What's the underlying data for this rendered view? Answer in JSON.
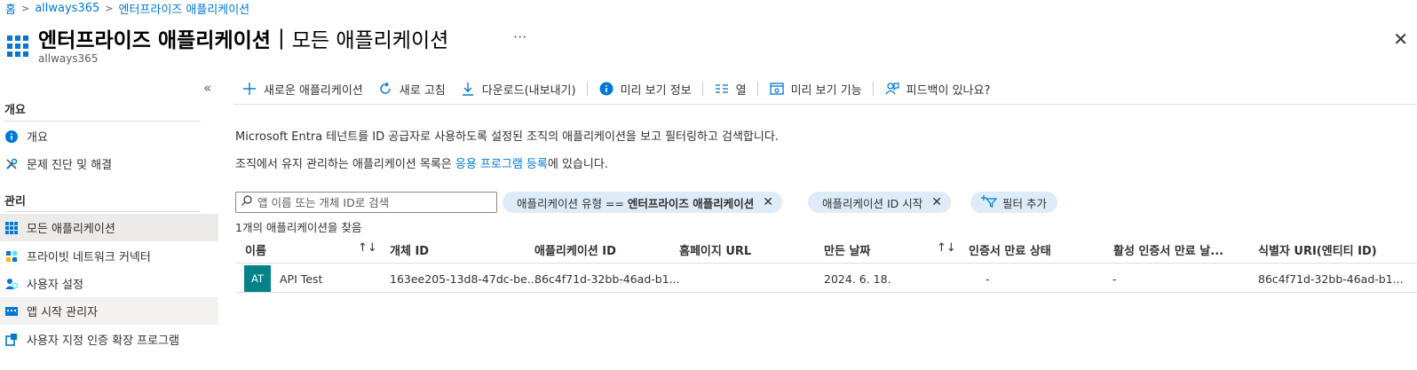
{
  "breadcrumb": {
    "items": [
      "홈",
      "allways365",
      "엔터프라이즈 애플리케이션"
    ]
  },
  "header": {
    "title": "엔터프라이즈 애플리케이션",
    "separator": "|",
    "title_sub": "모든 애플리케이션",
    "more": "···",
    "subtitle": "allways365",
    "close": "✕"
  },
  "nav": {
    "collapse": "«",
    "sections": [
      {
        "heading": "개요",
        "items": [
          {
            "label": "개요",
            "icon": "info-icon"
          },
          {
            "label": "문제 진단 및 해결",
            "icon": "wrench-icon"
          }
        ]
      },
      {
        "heading": "관리",
        "items": [
          {
            "label": "모든 애플리케이션",
            "icon": "grid-icon",
            "selected": true
          },
          {
            "label": "프라이빗 네트워크 커넥터",
            "icon": "connector-icon"
          },
          {
            "label": "사용자 설정",
            "icon": "users-settings-icon"
          },
          {
            "label": "앱 시작 관리자",
            "icon": "app-launcher-icon"
          },
          {
            "label": "사용자 지정 인증 확장 프로그램",
            "icon": "extension-icon"
          }
        ]
      }
    ]
  },
  "toolbar": {
    "new_app": "새로운 애플리케이션",
    "refresh": "새로 고침",
    "download": "다운로드(내보내기)",
    "preview_info": "미리 보기 정보",
    "columns": "열",
    "preview_features": "미리 보기 기능",
    "feedback": "피드백이 있나요?"
  },
  "description": {
    "line1": "Microsoft Entra 테넌트를 ID 공급자로 사용하도록 설정된 조직의 애플리케이션을 보고 필터링하고 검색합니다.",
    "line2_prefix": "조직에서 유지 관리하는 애플리케이션 목록은 ",
    "line2_link": "응용 프로그램 등록",
    "line2_suffix": "에 있습니다."
  },
  "filters": {
    "search_placeholder": "앱 이름 또는 개체 ID로 검색",
    "pill1_prefix": "애플리케이션 유형 == ",
    "pill1_value": "엔터프라이즈 애플리케이션",
    "pill2": "애플리케이션 ID 시작",
    "add_filter": "필터 추가",
    "result_count": "1개의 애플리케이션을 찾음"
  },
  "table": {
    "columns": [
      "이름",
      "개체 ID",
      "애플리케이션 ID",
      "홈페이지 URL",
      "만든 날짜",
      "인증서 만료 상태",
      "활성 인증서 만료 날...",
      "식별자 URI(엔티티 ID)"
    ],
    "sort_glyph": "↑↓",
    "rows": [
      {
        "avatar": "AT",
        "name": "API Test",
        "object_id": "163ee205-13d8-47dc-be...",
        "app_id": "86c4f71d-32bb-46ad-b1...",
        "homepage": "",
        "created": "2024. 6. 18.",
        "cert_status": "-",
        "cert_expiry": "-",
        "identifier_uri": "86c4f71d-32bb-46ad-b1..."
      }
    ]
  },
  "colors": {
    "accent": "#0078d4",
    "avatar_bg": "#038387",
    "pill_bg": "#deecf9",
    "selected_bg": "#edebe9"
  }
}
